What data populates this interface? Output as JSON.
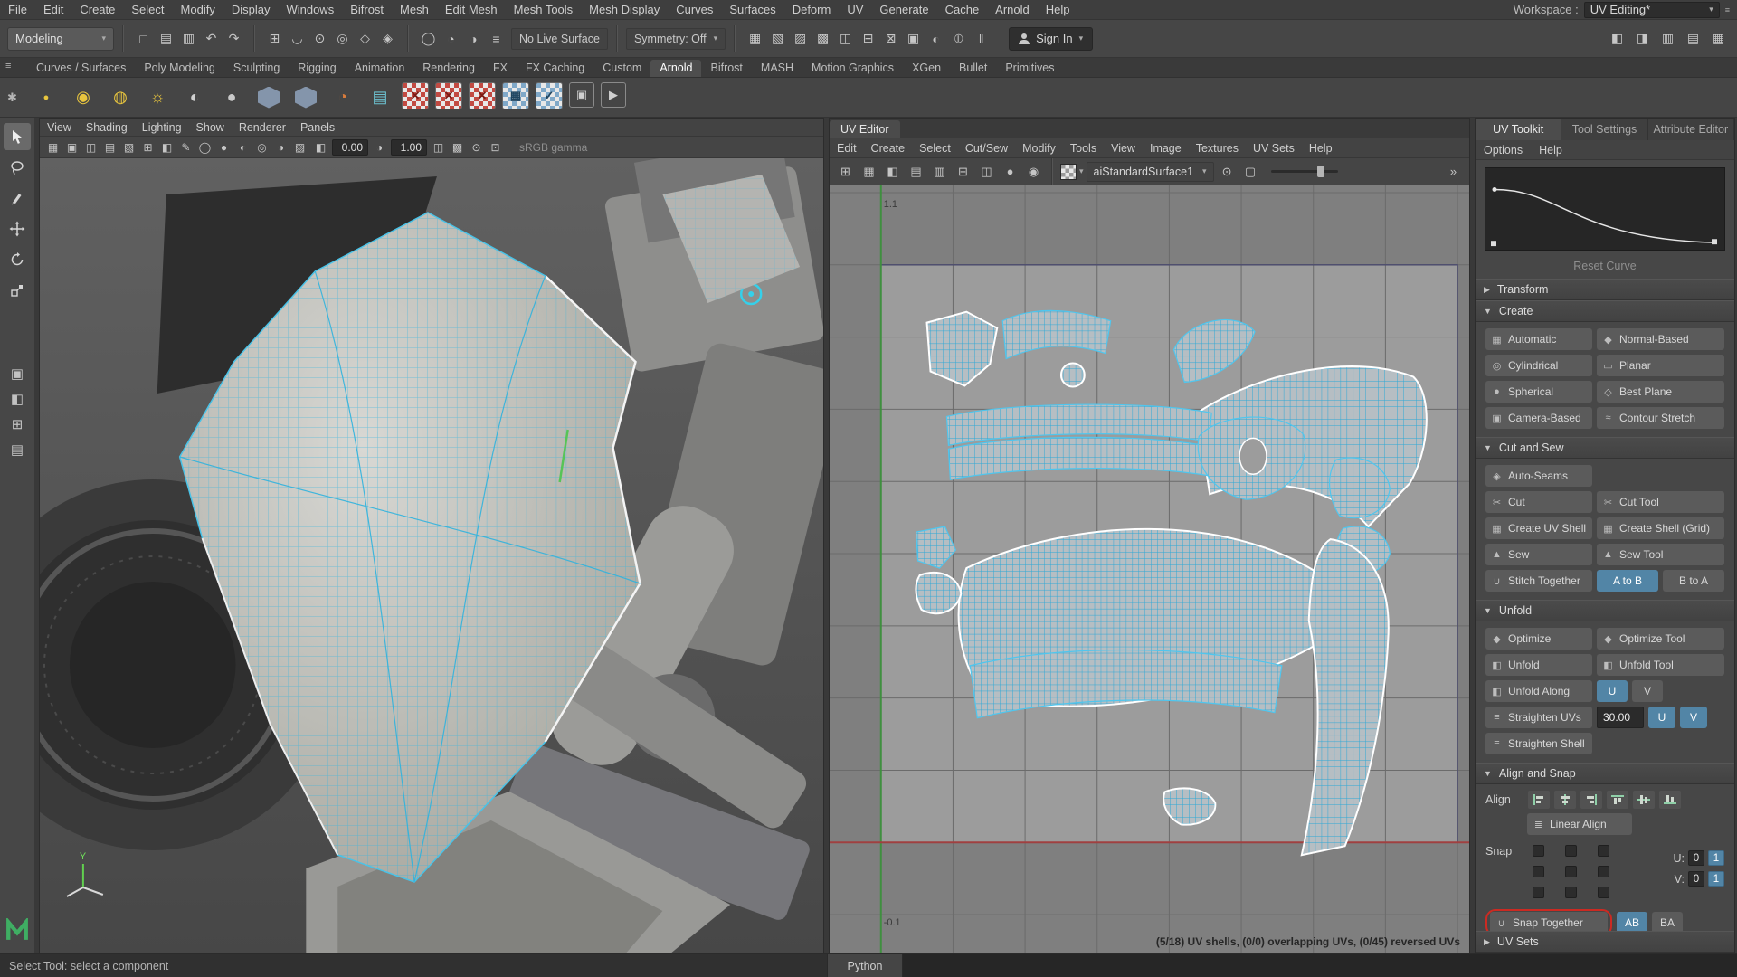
{
  "menubar": {
    "items": [
      "File",
      "Edit",
      "Create",
      "Select",
      "Modify",
      "Display",
      "Windows",
      "Bifrost",
      "Mesh",
      "Edit Mesh",
      "Mesh Tools",
      "Mesh Display",
      "Curves",
      "Surfaces",
      "Deform",
      "UV",
      "Generate",
      "Cache",
      "Arnold",
      "Help"
    ],
    "workspace_label": "Workspace :",
    "workspace_value": "UV Editing*"
  },
  "toolbar": {
    "mode": "Modeling",
    "live_surface": "No Live Surface",
    "symmetry": "Symmetry: Off",
    "sign_in": "Sign In",
    "left_icons": [
      {
        "name": "new-scene-icon",
        "glyph": "□"
      },
      {
        "name": "open-scene-icon",
        "glyph": "▤"
      },
      {
        "name": "save-scene-icon",
        "glyph": "▥"
      },
      {
        "name": "undo-icon",
        "glyph": "↶"
      },
      {
        "name": "redo-icon",
        "glyph": "↷"
      }
    ],
    "snap_icons": [
      {
        "name": "snap-to-grid-icon",
        "glyph": "⊞"
      },
      {
        "name": "snap-to-curve-icon",
        "glyph": "◡"
      },
      {
        "name": "snap-to-point-icon",
        "glyph": "⊙"
      },
      {
        "name": "snap-to-projected-center-icon",
        "glyph": "◎"
      },
      {
        "name": "snap-to-plane-icon",
        "glyph": "◇"
      },
      {
        "name": "make-live-icon",
        "glyph": "◈"
      }
    ],
    "history_icons": [
      {
        "name": "input-connections-icon",
        "glyph": "◯"
      },
      {
        "name": "output-connections-icon",
        "glyph": "◔"
      },
      {
        "name": "construction-history-icon",
        "glyph": "◑"
      },
      {
        "name": "list-icon",
        "glyph": "≡"
      }
    ],
    "render_icons": [
      {
        "name": "open-render-view-icon",
        "glyph": "▦"
      },
      {
        "name": "render-current-frame-icon",
        "glyph": "▧"
      },
      {
        "name": "ipr-render-icon",
        "glyph": "▨"
      },
      {
        "name": "render-settings-icon",
        "glyph": "▩"
      },
      {
        "name": "display-layers-icon",
        "glyph": "◫"
      },
      {
        "name": "anim-layers-icon",
        "glyph": "⊟"
      },
      {
        "name": "paint-effects-icon",
        "glyph": "⊠"
      },
      {
        "name": "hypershade-icon",
        "glyph": "▣"
      },
      {
        "name": "toggle-a-icon",
        "glyph": "◐"
      },
      {
        "name": "toggle-b-icon",
        "glyph": "⦶"
      },
      {
        "name": "toggle-c-icon",
        "glyph": "‖"
      }
    ],
    "right_icons": [
      {
        "name": "show-modeling-toolkit-icon",
        "glyph": "◧"
      },
      {
        "name": "show-hypershade-panel-icon",
        "glyph": "◨"
      },
      {
        "name": "show-tool-settings-icon",
        "glyph": "▥"
      },
      {
        "name": "show-attribute-editor-icon",
        "glyph": "▤"
      },
      {
        "name": "show-channel-box-icon",
        "glyph": "▦"
      }
    ]
  },
  "shelf": {
    "tabs": [
      {
        "label": "Curves / Surfaces"
      },
      {
        "label": "Poly Modeling"
      },
      {
        "label": "Sculpting"
      },
      {
        "label": "Rigging"
      },
      {
        "label": "Animation"
      },
      {
        "label": "Rendering"
      },
      {
        "label": "FX"
      },
      {
        "label": "FX Caching"
      },
      {
        "label": "Custom"
      },
      {
        "label": "Arnold",
        "active": true
      },
      {
        "label": "Bifrost"
      },
      {
        "label": "MASH"
      },
      {
        "label": "Motion Graphics"
      },
      {
        "label": "XGen"
      },
      {
        "label": "Bullet"
      },
      {
        "label": "Primitives"
      }
    ],
    "icons": [
      {
        "name": "arnold-area-light-icon",
        "cls": "ic-yellow-dot",
        "glyph": "●"
      },
      {
        "name": "arnold-skydome-light-icon",
        "cls": "ic-yellow",
        "glyph": "◉"
      },
      {
        "name": "arnold-mesh-light-icon",
        "cls": "ic-yellow",
        "glyph": "◍"
      },
      {
        "name": "arnold-photometric-light-icon",
        "cls": "ic-yellow",
        "glyph": "☼"
      },
      {
        "name": "arnold-physical-sky-icon",
        "cls": "ic-globe",
        "glyph": "◐"
      },
      {
        "name": "arnold-standin-sphere-icon",
        "cls": "ic-gray",
        "glyph": "●"
      },
      {
        "name": "arnold-standin-icon",
        "cls": "ic-hex",
        "glyph": ""
      },
      {
        "name": "arnold-export-standin-icon",
        "cls": "ic-hex",
        "glyph": ""
      },
      {
        "name": "arnold-volume-icon",
        "cls": "ic-orange",
        "glyph": "◔"
      },
      {
        "name": "arnold-aov-browser-icon",
        "cls": "ic-teal",
        "glyph": "▤"
      },
      {
        "name": "arnold-flush-texture-cache-icon",
        "cls": "ic-checker-red",
        "glyph": "✕"
      },
      {
        "name": "arnold-flush-skydome-cache-icon",
        "cls": "ic-checker-red",
        "glyph": "✕"
      },
      {
        "name": "arnold-flush-all-caches-icon",
        "cls": "ic-checker-red",
        "glyph": "✕"
      },
      {
        "name": "arnold-tx-manager-icon",
        "cls": "ic-checker-blue",
        "glyph": "▦"
      },
      {
        "name": "arnold-tx-update-icon",
        "cls": "ic-checker-blue",
        "glyph": "✓"
      },
      {
        "name": "arnold-render-icon",
        "cls": "ic-box",
        "glyph": "▣"
      },
      {
        "name": "arnold-ipr-icon",
        "cls": "ic-box",
        "glyph": "▶"
      }
    ]
  },
  "viewport": {
    "menus": [
      "View",
      "Shading",
      "Lighting",
      "Show",
      "Renderer",
      "Panels"
    ],
    "icons": [
      {
        "name": "select-camera-icon",
        "glyph": "▦"
      },
      {
        "name": "lock-camera-icon",
        "glyph": "▣"
      },
      {
        "name": "camera-attributes-icon",
        "glyph": "◫"
      },
      {
        "name": "bookmark-icon",
        "glyph": "▤"
      },
      {
        "name": "image-plane-icon",
        "glyph": "▧"
      },
      {
        "name": "two-d-pan-zoom-icon",
        "glyph": "⊞"
      },
      {
        "name": "oversan-icon",
        "glyph": "◧"
      },
      {
        "name": "greasepencil-icon",
        "glyph": "✎"
      },
      {
        "name": "wireframe-icon",
        "glyph": "◯"
      },
      {
        "name": "shaded-icon",
        "glyph": "●"
      },
      {
        "name": "textured-icon",
        "glyph": "◐"
      },
      {
        "name": "lights-icon",
        "glyph": "◎"
      },
      {
        "name": "shadows-icon",
        "glyph": "◑"
      },
      {
        "name": "screen-space-ao-icon",
        "glyph": "▨"
      }
    ],
    "icons_after": [
      {
        "name": "motion-blur-icon",
        "glyph": "◫"
      },
      {
        "name": "multisample-icon",
        "glyph": "▩"
      },
      {
        "name": "depth-of-field-icon",
        "glyph": "⊙"
      },
      {
        "name": "isolate-select-icon",
        "glyph": "⊡"
      }
    ],
    "exposure_icon": "◧",
    "gamma_icon": "◑",
    "exposure": "0.00",
    "gamma": "1.00",
    "colorspace": "sRGB gamma",
    "axis_y": "Y"
  },
  "uv_editor": {
    "title": "UV Editor",
    "menus": [
      "Edit",
      "Create",
      "Select",
      "Cut/Sew",
      "Modify",
      "Tools",
      "View",
      "Image",
      "Textures",
      "UV Sets",
      "Help"
    ],
    "toolbar_icons": [
      {
        "name": "uv-grid-icon",
        "glyph": "⊞"
      },
      {
        "name": "uv-snap-icon",
        "glyph": "▦"
      },
      {
        "name": "uv-shell-border-icon",
        "glyph": "◧"
      },
      {
        "name": "uv-texture-borders-icon",
        "glyph": "▤"
      },
      {
        "name": "uv-checker-icon",
        "glyph": "▥"
      },
      {
        "name": "uv-distortion-icon",
        "glyph": "⊟"
      },
      {
        "name": "uv-shade-icon",
        "glyph": "◫"
      },
      {
        "name": "uv-dim-image-icon",
        "glyph": "●"
      },
      {
        "name": "uv-pixel-snap-icon",
        "glyph": "◉"
      }
    ],
    "material": "aiStandardSurface1",
    "right_icons": [
      {
        "name": "uv-baked-texture-icon",
        "glyph": "⊙"
      },
      {
        "name": "uv-image-range-icon",
        "glyph": "▢"
      }
    ],
    "expand_icon": "»",
    "grid_label_top": "1.1",
    "grid_label_bottom": "-0.1",
    "status": "(5/18) UV shells, (0/0) overlapping UVs, (0/45) reversed UVs"
  },
  "toolkit": {
    "tabs": [
      {
        "label": "UV Toolkit",
        "active": true
      },
      {
        "label": "Tool Settings"
      },
      {
        "label": "Attribute Editor"
      }
    ],
    "menus": [
      "Options",
      "Help"
    ],
    "reset_curve": "Reset Curve",
    "sections": {
      "transform": "Transform",
      "create": "Create",
      "cut_and_sew": "Cut and Sew",
      "unfold": "Unfold",
      "align_and_snap": "Align and Snap",
      "uv_sets": "UV Sets"
    },
    "create_buttons": [
      {
        "name": "automatic-projection-button",
        "glyph": "▦",
        "label": "Automatic"
      },
      {
        "name": "normal-based-projection-button",
        "glyph": "◆",
        "label": "Normal-Based"
      },
      {
        "name": "cylindrical-projection-button",
        "glyph": "◎",
        "label": "Cylindrical"
      },
      {
        "name": "planar-projection-button",
        "glyph": "▭",
        "label": "Planar"
      },
      {
        "name": "spherical-projection-button",
        "glyph": "●",
        "label": "Spherical"
      },
      {
        "name": "best-plane-projection-button",
        "glyph": "◇",
        "label": "Best Plane"
      },
      {
        "name": "camera-based-projection-button",
        "glyph": "▣",
        "label": "Camera-Based"
      },
      {
        "name": "contour-stretch-projection-button",
        "glyph": "≈",
        "label": "Contour Stretch"
      }
    ],
    "cut_sew": {
      "auto_seams": "Auto-Seams",
      "cut": "Cut",
      "cut_tool": "Cut Tool",
      "create_uv_shell": "Create UV Shell",
      "create_shell_grid": "Create Shell (Grid)",
      "sew": "Sew",
      "sew_tool": "Sew Tool",
      "stitch_together": "Stitch Together",
      "a_to_b": "A to B",
      "b_to_a": "B to A"
    },
    "unfold": {
      "optimize": "Optimize",
      "optimize_tool": "Optimize Tool",
      "unfold": "Unfold",
      "unfold_tool": "Unfold Tool",
      "unfold_along": "Unfold Along",
      "u": "U",
      "v": "V",
      "straighten_uvs": "Straighten UVs",
      "angle": "30.00",
      "straighten_shell": "Straighten Shell"
    },
    "align_snap": {
      "align_label": "Align",
      "linear_align": "Linear Align",
      "snap_label": "Snap",
      "u_label": "U:",
      "v_label": "V:",
      "u_val_0": "0",
      "u_val_1": "1",
      "v_val_0": "0",
      "v_val_1": "1",
      "snap_together": "Snap Together",
      "ab": "AB",
      "ba": "BA"
    }
  },
  "statusbar": {
    "help_line": "Select Tool: select a component",
    "command_language": "Python"
  },
  "icons": {
    "dropdown": "▾",
    "section_open": "▼",
    "section_closed": "▶",
    "cut": "✂",
    "sew": "▲",
    "shell": "▦",
    "stitch": "∪",
    "optimize": "◆",
    "unfold": "◧",
    "straighten": "≡",
    "auto_seams": "◈",
    "linear_align": "≣",
    "menu_burger": "≡",
    "gear": "✱",
    "maya_logo": "M"
  },
  "colors": {
    "accent_cyan": "#3fc1e8",
    "selection_blue": "#5285a6",
    "annotation_red": "#cc2a22"
  }
}
